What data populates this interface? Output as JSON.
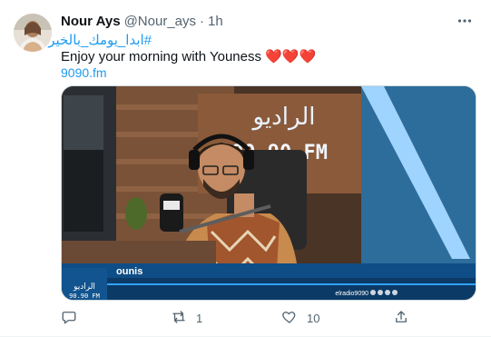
{
  "tweet": {
    "display_name": "Nour Ays",
    "handle": "@Nour_ays",
    "separator": "·",
    "time": "1h",
    "hashtag": "#ابدا_يومك_بالخير",
    "text": "Enjoy your morning with Youness ❤️❤️❤️",
    "link": "9090.fm"
  },
  "media": {
    "sign_arabic": "الراديو",
    "sign_freq": "90.90 FM",
    "lower_third_name": "ounis",
    "lower_third_logo_arabic": "الراديو",
    "lower_third_logo_freq": "90.90 FM",
    "ticker_handle": "elradio9090"
  },
  "actions": {
    "reply_icon": "reply-icon",
    "retweet_icon": "retweet-icon",
    "retweet_count": "1",
    "like_icon": "heart-icon",
    "like_count": "10",
    "share_icon": "share-icon"
  },
  "colors": {
    "link_blue": "#1d9bf0",
    "text_primary": "#0f1419",
    "text_secondary": "#536471",
    "lower_third_blue": "#0b3a66"
  }
}
